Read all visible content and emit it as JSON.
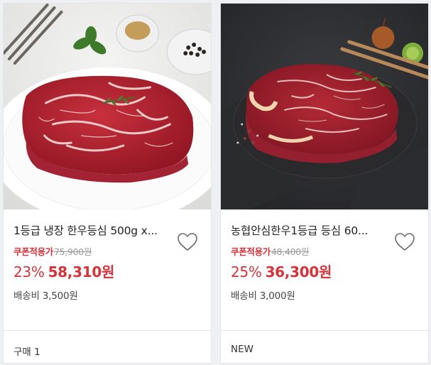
{
  "products": [
    {
      "title": "1등급 냉장 한우등심 500g x...",
      "coupon_label": "쿠폰적용가",
      "original_price": "75,900원",
      "discount_rate": "23%",
      "sale_price": "58,310원",
      "shipping": "배송비 3,500원",
      "footer": "구매 1",
      "image_icon": "ribeye-steak-on-white-plate-image"
    },
    {
      "title": "농협안심한우1등급 등심 60...",
      "coupon_label": "쿠폰적용가",
      "original_price": "48,400원",
      "discount_rate": "25%",
      "sale_price": "36,300원",
      "shipping": "배송비 3,000원",
      "footer": "NEW",
      "image_icon": "sirloin-steak-on-slate-image"
    }
  ],
  "colors": {
    "accent": "#d6323a",
    "text": "#222222",
    "muted": "#999999",
    "background": "#eef0f3"
  },
  "icons": {
    "wishlist": "heart-outline-icon"
  }
}
